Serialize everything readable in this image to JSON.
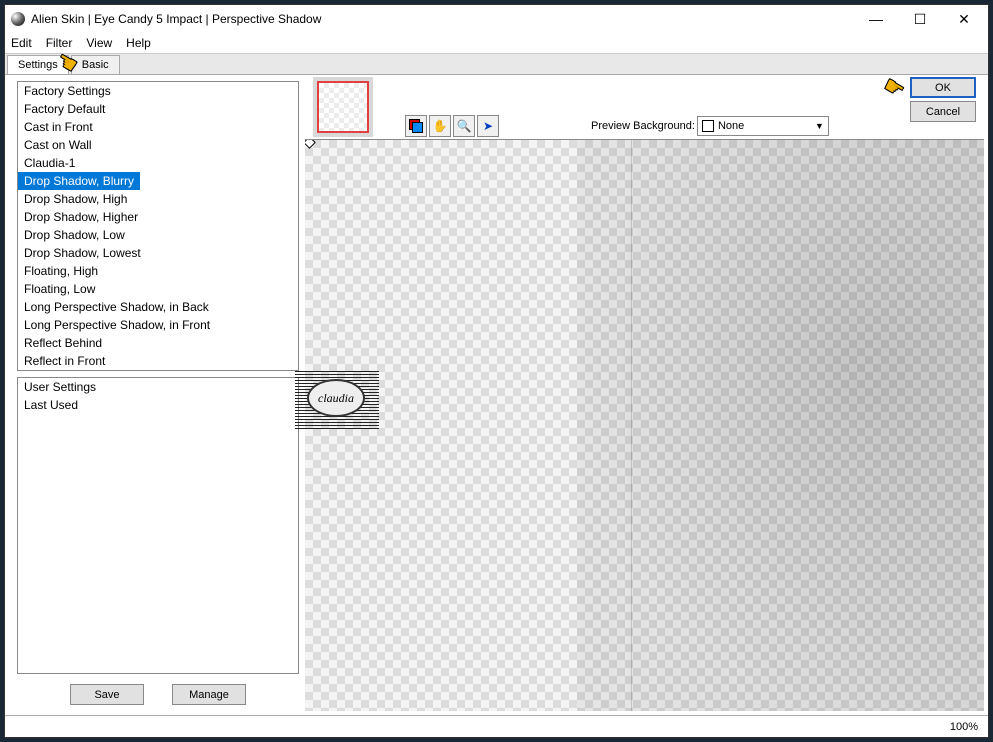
{
  "window": {
    "title": "Alien Skin | Eye Candy 5 Impact | Perspective Shadow"
  },
  "menu": {
    "edit": "Edit",
    "filter": "Filter",
    "view": "View",
    "help": "Help"
  },
  "tabs": {
    "settings": "Settings",
    "basic": "Basic"
  },
  "factory": {
    "header": "Factory Settings",
    "items": [
      "Factory Default",
      "Cast in Front",
      "Cast on Wall",
      "Claudia-1",
      "Drop Shadow, Blurry",
      "Drop Shadow, High",
      "Drop Shadow, Higher",
      "Drop Shadow, Low",
      "Drop Shadow, Lowest",
      "Floating, High",
      "Floating, Low",
      "Long Perspective Shadow, in Back",
      "Long Perspective Shadow, in Front",
      "Reflect Behind",
      "Reflect in Front"
    ],
    "selected_index": 4
  },
  "user": {
    "header": "User Settings",
    "items": [
      "Last Used"
    ]
  },
  "buttons": {
    "save": "Save",
    "manage": "Manage",
    "ok": "OK",
    "cancel": "Cancel"
  },
  "preview": {
    "label": "Preview Background:",
    "selected": "None"
  },
  "status": {
    "zoom": "100%"
  },
  "watermark": {
    "text": "claudia"
  }
}
